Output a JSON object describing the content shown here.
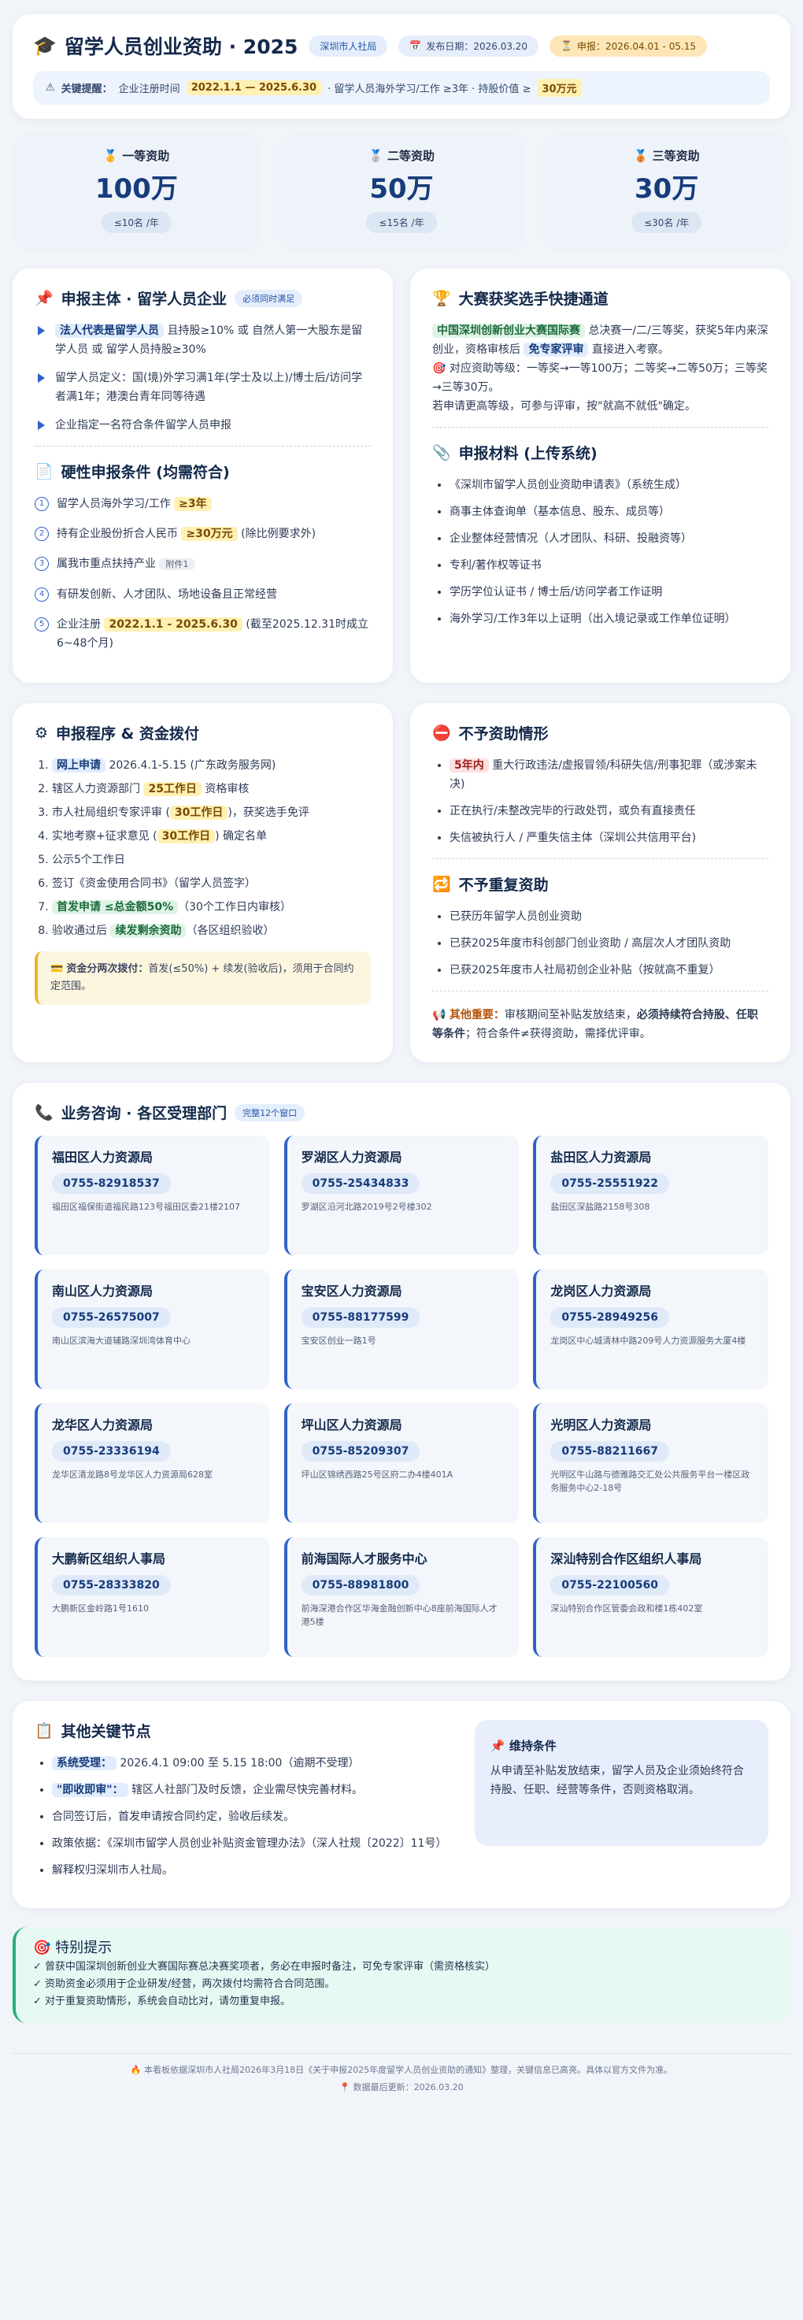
{
  "header": {
    "title": "留学人员创业资助 · 2025",
    "org": "深圳市人社局",
    "publish": "发布日期：2026.03.20",
    "apply": "申报：2026.04.01 - 05.15",
    "key_label": "关键提醒：",
    "key_text1": "企业注册时间",
    "key_range": "2022.1.1 — 2025.6.30",
    "key_text2": "· 留学人员海外学习/工作 ≥3年 · 持股价值 ≥",
    "key_amount": "30万元"
  },
  "awards": [
    {
      "level": "一等资助",
      "amount": "100万",
      "quota": "≤10名 /年"
    },
    {
      "level": "二等资助",
      "amount": "50万",
      "quota": "≤15名 /年"
    },
    {
      "level": "三等资助",
      "amount": "30万",
      "quota": "≤30名 /年"
    }
  ],
  "subject": {
    "title": "申报主体 · 留学人员企业",
    "tag": "必须同时满足",
    "items": [
      {
        "chip": "法人代表是留学人员",
        "text": " 且持股≥10% 或 自然人第一大股东是留学人员 或 留学人员持股≥30%"
      },
      {
        "chip": "",
        "text": "留学人员定义：国(境)外学习满1年(学士及以上)/博士后/访问学者满1年；港澳台青年同等待遇"
      },
      {
        "chip": "",
        "text": "企业指定一名符合条件留学人员申报"
      }
    ]
  },
  "hard": {
    "title": "硬性申报条件 (均需符合)",
    "items": [
      {
        "n": "1",
        "text": "留学人员海外学习/工作 ",
        "chip": "≥3年",
        "after": ""
      },
      {
        "n": "2",
        "text": "持有企业股份折合人民币 ",
        "chip": "≥30万元",
        "after": " (除比例要求外)"
      },
      {
        "n": "3",
        "text": "属我市重点扶持产业 ",
        "chip": "附件1",
        "after": ""
      },
      {
        "n": "4",
        "text": "有研发创新、人才团队、场地设备且正常经营",
        "chip": "",
        "after": ""
      },
      {
        "n": "5",
        "text": "企业注册 ",
        "chip": "2022.1.1 - 2025.6.30",
        "after": " (截至2025.12.31时成立6~48个月)"
      }
    ]
  },
  "contest": {
    "title": "大赛获奖选手快捷通道",
    "chip1": "中国深圳创新创业大赛国际赛",
    "t1": " 总决赛一/二/三等奖，获奖5年内来深创业，资格审核后 ",
    "chip2": "免专家评审",
    "t2": " 直接进入考察。",
    "t3": "对应资助等级：一等奖→一等100万；二等奖→二等50万；三等奖→三等30万。",
    "t4": "若申请更高等级，可参与评审，按\"就高不就低\"确定。"
  },
  "materials": {
    "title": "申报材料 (上传系统)",
    "items": [
      "《深圳市留学人员创业资助申请表》（系统生成）",
      "商事主体查询单（基本信息、股东、成员等）",
      "企业整体经营情况（人才团队、科研、投融资等）",
      "专利/著作权等证书",
      "学历学位认证书 / 博士后/访问学者工作证明",
      "海外学习/工作3年以上证明（出入境记录或工作单位证明）"
    ]
  },
  "process": {
    "title": "申报程序 & 资金拨付",
    "steps": [
      {
        "chip": "网上申请",
        "text": " 2026.4.1-5.15 (广东政务服务网)"
      },
      {
        "chip": "",
        "text": "辖区人力资源部门 ",
        "chip2": "25工作日",
        "after": " 资格审核"
      },
      {
        "chip": "",
        "text": "市人社局组织专家评审 (",
        "chip2": "30工作日",
        "after": ")，获奖选手免评"
      },
      {
        "chip": "",
        "text": "实地考察+征求意见 (",
        "chip2": "30工作日",
        "after": ") 确定名单"
      },
      {
        "chip": "",
        "text": "公示5个工作日"
      },
      {
        "chip": "",
        "text": "签订《资金使用合同书》（留学人员签字）"
      },
      {
        "chip": "首发申请 ≤总金额50%",
        "text": "（30个工作日内审核）"
      },
      {
        "chip": "",
        "text": "验收通过后 ",
        "chip3": "续发剩余资助",
        "after": "（各区组织验收）"
      }
    ],
    "note_label": "资金分两次拨付：",
    "note_text": "首发(≤50%) + 续发(验收后)，须用于合同约定范围。"
  },
  "excluded": {
    "title": "不予资助情形",
    "items": [
      {
        "chip": "5年内",
        "text": " 重大行政违法/虚报冒领/科研失信/刑事犯罪（或涉案未决)"
      },
      {
        "chip": "",
        "text": "正在执行/未整改完毕的行政处罚，或负有直接责任"
      },
      {
        "chip": "",
        "text": "失信被执行人 / 严重失信主体（深圳公共信用平台)"
      }
    ]
  },
  "norepeat": {
    "title": "不予重复资助",
    "items": [
      "已获历年留学人员创业资助",
      "已获2025年度市科创部门创业资助 / 高层次人才团队资助",
      "已获2025年度市人社局初创企业补贴（按就高不重复）"
    ],
    "other_label": "其他重要：",
    "other_text": "审核期间至补贴发放结束，",
    "other_bold": "必须持续符合持股、任职等条件",
    "other_tail": "；符合条件≠获得资助，需择优评审。"
  },
  "contacts": {
    "title": "业务咨询 · 各区受理部门",
    "tag": "完整12个窗口",
    "items": [
      {
        "name": "福田区人力资源局",
        "tel": "0755-82918537",
        "addr": "福田区福保街道福民路123号福田区委21楼2107"
      },
      {
        "name": "罗湖区人力资源局",
        "tel": "0755-25434833",
        "addr": "罗湖区沿河北路2019号2号楼302"
      },
      {
        "name": "盐田区人力资源局",
        "tel": "0755-25551922",
        "addr": "盐田区深盐路2158号308"
      },
      {
        "name": "南山区人力资源局",
        "tel": "0755-26575007",
        "addr": "南山区滨海大道辅路深圳湾体育中心"
      },
      {
        "name": "宝安区人力资源局",
        "tel": "0755-88177599",
        "addr": "宝安区创业一路1号"
      },
      {
        "name": "龙岗区人力资源局",
        "tel": "0755-28949256",
        "addr": "龙岗区中心城清林中路209号人力资源服务大厦4楼"
      },
      {
        "name": "龙华区人力资源局",
        "tel": "0755-23336194",
        "addr": "龙华区清龙路8号龙华区人力资源局628室"
      },
      {
        "name": "坪山区人力资源局",
        "tel": "0755-85209307",
        "addr": "坪山区锦绣西路25号区府二办4楼401A"
      },
      {
        "name": "光明区人力资源局",
        "tel": "0755-88211667",
        "addr": "光明区牛山路与德雅路交汇处公共服务平台一楼区政务服务中心2-18号"
      },
      {
        "name": "大鹏新区组织人事局",
        "tel": "0755-28333820",
        "addr": "大鹏新区金岭路1号1610"
      },
      {
        "name": "前海国际人才服务中心",
        "tel": "0755-88981800",
        "addr": "前海深港合作区华海金融创新中心8座前海国际人才港5楼"
      },
      {
        "name": "深汕特别合作区组织人事局",
        "tel": "0755-22100560",
        "addr": "深汕特别合作区管委会政和楼1栋402室"
      }
    ]
  },
  "milestones": {
    "title": "其他关键节点",
    "items": [
      {
        "chip": "系统受理：",
        "text": " 2026.4.1 09:00 至 5.15 18:00（逾期不受理）"
      },
      {
        "chip": "\"即收即审\"：",
        "text": " 辖区人社部门及时反馈，企业需尽快完善材料。"
      },
      {
        "chip": "",
        "text": "合同签订后，首发申请按合同约定，验收后续发。"
      },
      {
        "chip": "",
        "text": "政策依据：《深圳市留学人员创业补贴资金管理办法》（深人社规〔2022〕11号）"
      },
      {
        "chip": "",
        "text": "解释权归深圳市人社局。"
      }
    ],
    "keep_title": "维持条件",
    "keep_text": "从申请至补贴发放结束，留学人员及企业须始终符合持股、任职、经营等条件，否则资格取消。"
  },
  "tip": {
    "title": "特别提示",
    "lines": [
      "✓ 曾获中国深圳创新创业大赛国际赛总决赛奖项者，务必在申报时备注，可免专家评审（需资格核实）",
      "✓ 资助资金必须用于企业研发/经营，两次拨付均需符合合同范围。",
      "✓ 对于重复资助情形，系统会自动比对，请勿重复申报。"
    ]
  },
  "footer": {
    "line1": "本看板依据深圳市人社局2026年3月18日《关于申报2025年度留学人员创业资助的通知》整理，关键信息已高亮。具体以官方文件为准。",
    "line2": "数据最后更新：2026.03.20"
  }
}
